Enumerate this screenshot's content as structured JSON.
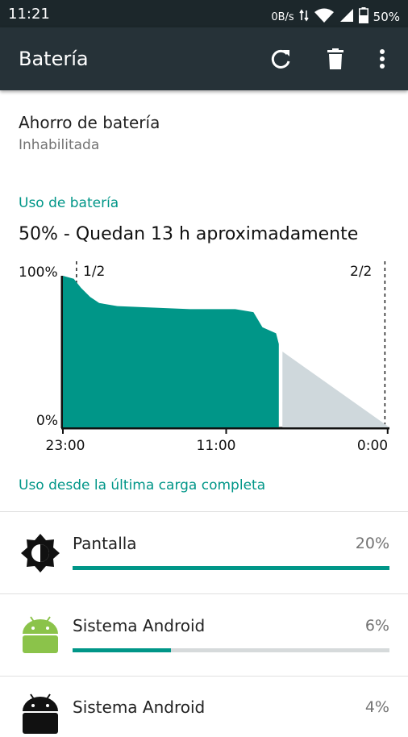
{
  "status_bar": {
    "time": "11:21",
    "net_speed": "0B/s",
    "battery": "50%"
  },
  "app_bar": {
    "title": "Batería",
    "refresh_icon": "refresh-icon",
    "delete_icon": "trash-icon",
    "menu_icon": "more-vert-icon"
  },
  "battery_saver": {
    "title": "Ahorro de batería",
    "status": "Inhabilitada"
  },
  "usage": {
    "heading": "Uso de batería",
    "summary": "50% - Quedan 13 h aproximadamente"
  },
  "chart_data": {
    "type": "area",
    "y_labels": {
      "top": "100%",
      "bottom": "0%"
    },
    "x_ticks": [
      "23:00",
      "11:00",
      "0:00"
    ],
    "markers": [
      "1/2",
      "2/2"
    ],
    "series": [
      {
        "points": [
          [
            0,
            100
          ],
          [
            1.2,
            98
          ],
          [
            2,
            92
          ],
          [
            3,
            86
          ],
          [
            4,
            82
          ],
          [
            6,
            80
          ],
          [
            14,
            78
          ],
          [
            19,
            78
          ],
          [
            21,
            76
          ],
          [
            22,
            66
          ],
          [
            23.5,
            62
          ],
          [
            23.8,
            55
          ]
        ],
        "color": "#009688"
      },
      {
        "points": [
          [
            24.2,
            50
          ],
          [
            36,
            0
          ]
        ],
        "color": "#cfd8dc"
      }
    ]
  },
  "since_full_charge": {
    "heading": "Uso desde la última carga completa"
  },
  "apps": [
    {
      "name": "Pantalla",
      "percent": "20%",
      "fraction": 1.0,
      "icon": "brightness-icon"
    },
    {
      "name": "Sistema Android",
      "percent": "6%",
      "fraction": 0.31,
      "icon": "android-icon"
    },
    {
      "name": "Sistema Android",
      "percent": "4%",
      "fraction": 0.2,
      "icon": "android-black-icon"
    }
  ],
  "colors": {
    "accent": "#009688",
    "app_bar": "#263238",
    "status_bar": "#1c272b",
    "projection": "#cfd8dc"
  }
}
